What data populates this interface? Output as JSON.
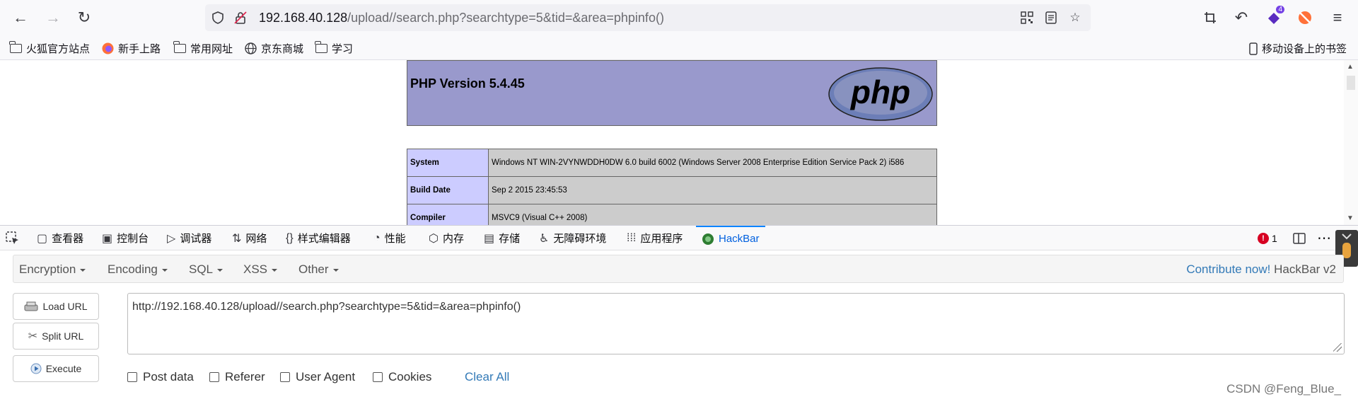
{
  "browser": {
    "url_host": "192.168.40.128",
    "url_path": "/upload//search.php?searchtype=5&tid=&area=phpinfo()",
    "extension_badge": "4"
  },
  "bookmarks": [
    {
      "label": "火狐官方站点"
    },
    {
      "label": "新手上路"
    },
    {
      "label": "常用网址"
    },
    {
      "label": "京东商城"
    },
    {
      "label": "学习"
    }
  ],
  "mobile_bookmarks": "移动设备上的书签",
  "phpinfo": {
    "version_title": "PHP Version 5.4.45",
    "logo_text": "php",
    "rows": [
      {
        "key": "System",
        "value": "Windows NT WIN-2VYNWDDH0DW 6.0 build 6002 (Windows Server 2008 Enterprise Edition Service Pack 2) i586"
      },
      {
        "key": "Build Date",
        "value": "Sep 2 2015 23:45:53"
      },
      {
        "key": "Compiler",
        "value": "MSVC9 (Visual C++ 2008)"
      }
    ]
  },
  "devtools": {
    "tabs": [
      {
        "label": "查看器",
        "icon": "inspector-icon"
      },
      {
        "label": "控制台",
        "icon": "console-icon"
      },
      {
        "label": "调试器",
        "icon": "debugger-icon"
      },
      {
        "label": "网络",
        "icon": "network-icon"
      },
      {
        "label": "样式编辑器",
        "icon": "style-editor-icon"
      },
      {
        "label": "性能",
        "icon": "performance-icon"
      },
      {
        "label": "内存",
        "icon": "memory-icon"
      },
      {
        "label": "存储",
        "icon": "storage-icon"
      },
      {
        "label": "无障碍环境",
        "icon": "accessibility-icon"
      },
      {
        "label": "应用程序",
        "icon": "application-icon"
      },
      {
        "label": "HackBar",
        "icon": "hackbar-icon"
      }
    ],
    "error_count": "1"
  },
  "hackbar": {
    "menus": [
      "Encryption",
      "Encoding",
      "SQL",
      "XSS",
      "Other"
    ],
    "contribute_link": "Contribute now!",
    "contribute_suffix": "HackBar v2",
    "buttons": {
      "load": "Load URL",
      "split": "Split URL",
      "execute": "Execute"
    },
    "url_value": "http://192.168.40.128/upload//search.php?searchtype=5&tid=&area=phpinfo()",
    "options": [
      "Post data",
      "Referer",
      "User Agent",
      "Cookies"
    ],
    "clear_all": "Clear All"
  },
  "watermark": "CSDN @Feng_Blue_",
  "colors": {
    "accent": "#0a84ff",
    "link": "#337ab7",
    "php_header": "#9999cc",
    "php_key": "#ccccff",
    "php_value": "#cccccc"
  }
}
